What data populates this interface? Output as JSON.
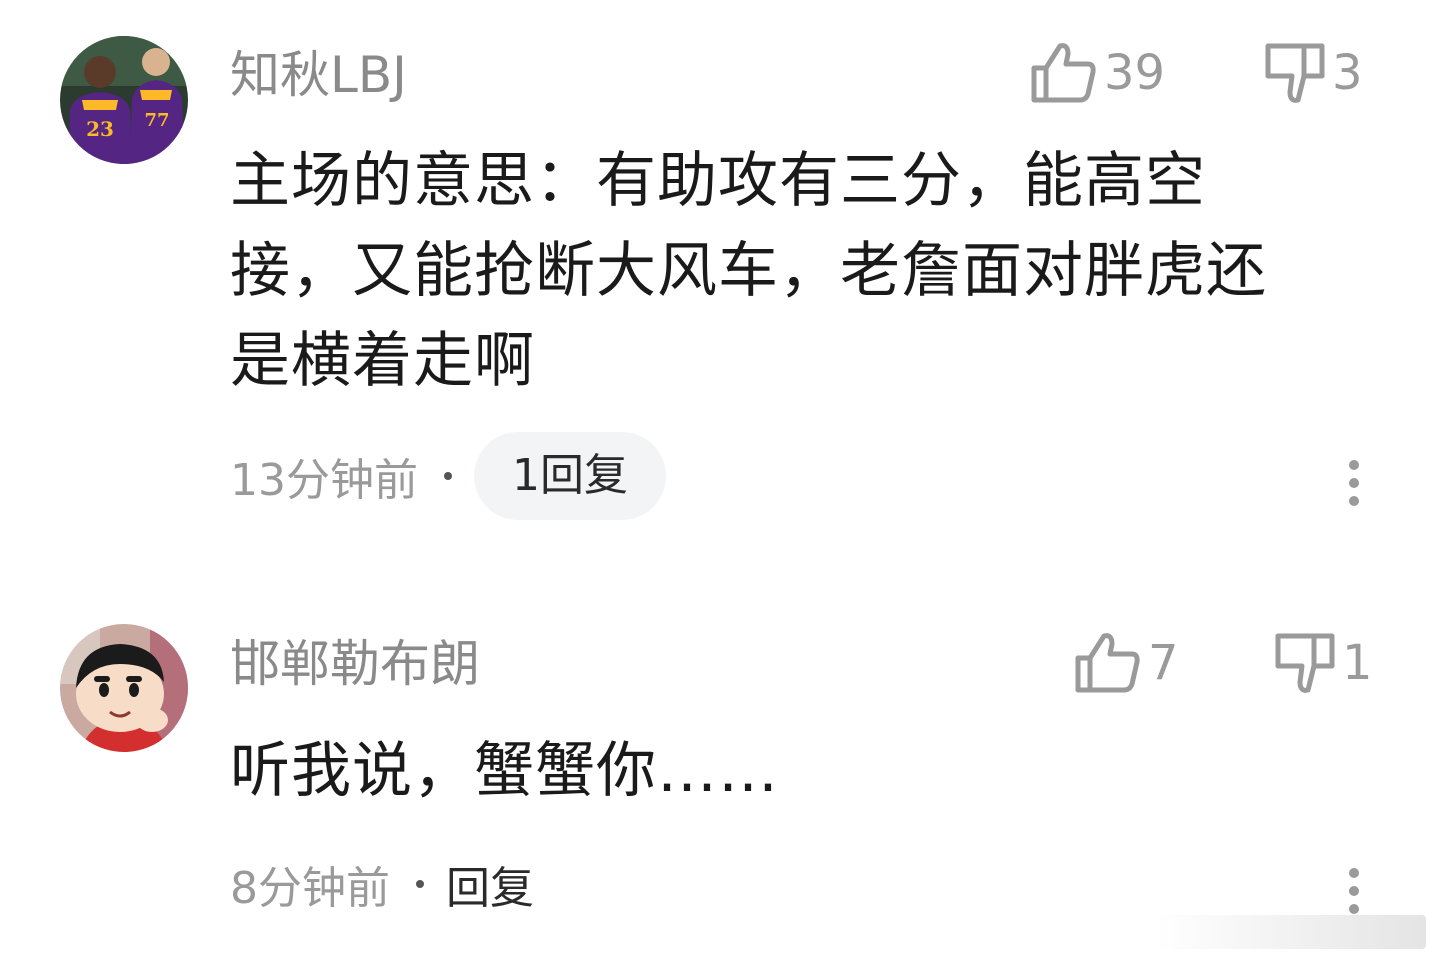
{
  "comments": [
    {
      "username": "知秋LBJ",
      "likes": "39",
      "dislikes": "3",
      "text_lines": [
        "主场的意思：有助攻有三分，能高空",
        "接，又能抢断大风车，老詹面对胖虎还",
        "是横着走啊"
      ],
      "time": "13分钟前",
      "reply_label": "1回复",
      "avatar_icon": "lakers-players-avatar"
    },
    {
      "username": "邯郸勒布朗",
      "likes": "7",
      "dislikes": "1",
      "text_lines": [
        "听我说，蟹蟹你……"
      ],
      "time": "8分钟前",
      "reply_label": "回复",
      "avatar_icon": "cartoon-boy-avatar"
    }
  ],
  "colors": {
    "meta_gray": "#9a9a9a",
    "text": "#1a1a1a",
    "pill_bg": "#f3f4f6",
    "lakers_purple": "#552583",
    "lakers_gold": "#fdb927"
  }
}
